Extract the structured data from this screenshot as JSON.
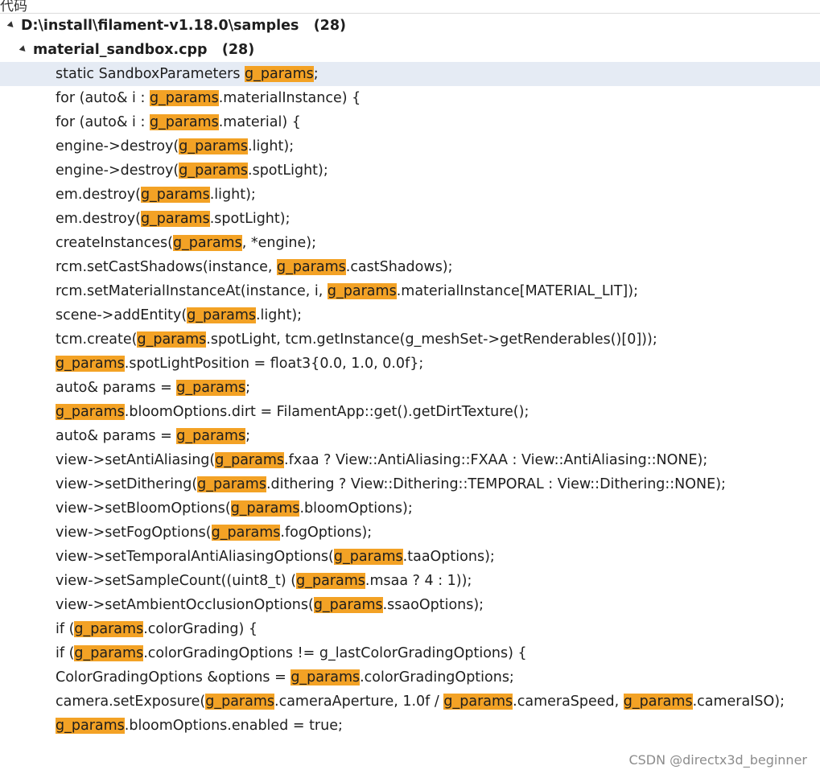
{
  "top_label": "代码",
  "tree": {
    "folder": {
      "path": "D:\\install\\filament-v1.18.0\\samples",
      "count": "(28)"
    },
    "file": {
      "name": "material_sandbox.cpp",
      "count": "(28)"
    }
  },
  "results": [
    {
      "selected": true,
      "segments": [
        {
          "t": "static SandboxParameters "
        },
        {
          "t": "g_params",
          "hl": true
        },
        {
          "t": ";"
        }
      ]
    },
    {
      "segments": [
        {
          "t": "for (auto& i : "
        },
        {
          "t": "g_params",
          "hl": true
        },
        {
          "t": ".materialInstance) {"
        }
      ]
    },
    {
      "segments": [
        {
          "t": "for (auto& i : "
        },
        {
          "t": "g_params",
          "hl": true
        },
        {
          "t": ".material) {"
        }
      ]
    },
    {
      "segments": [
        {
          "t": "engine->destroy("
        },
        {
          "t": "g_params",
          "hl": true
        },
        {
          "t": ".light);"
        }
      ]
    },
    {
      "segments": [
        {
          "t": "engine->destroy("
        },
        {
          "t": "g_params",
          "hl": true
        },
        {
          "t": ".spotLight);"
        }
      ]
    },
    {
      "segments": [
        {
          "t": "em.destroy("
        },
        {
          "t": "g_params",
          "hl": true
        },
        {
          "t": ".light);"
        }
      ]
    },
    {
      "segments": [
        {
          "t": "em.destroy("
        },
        {
          "t": "g_params",
          "hl": true
        },
        {
          "t": ".spotLight);"
        }
      ]
    },
    {
      "segments": [
        {
          "t": "createInstances("
        },
        {
          "t": "g_params",
          "hl": true
        },
        {
          "t": ", *engine);"
        }
      ]
    },
    {
      "segments": [
        {
          "t": "rcm.setCastShadows(instance, "
        },
        {
          "t": "g_params",
          "hl": true
        },
        {
          "t": ".castShadows);"
        }
      ]
    },
    {
      "segments": [
        {
          "t": "rcm.setMaterialInstanceAt(instance, i, "
        },
        {
          "t": "g_params",
          "hl": true
        },
        {
          "t": ".materialInstance[MATERIAL_LIT]);"
        }
      ]
    },
    {
      "segments": [
        {
          "t": "scene->addEntity("
        },
        {
          "t": "g_params",
          "hl": true
        },
        {
          "t": ".light);"
        }
      ]
    },
    {
      "segments": [
        {
          "t": "tcm.create("
        },
        {
          "t": "g_params",
          "hl": true
        },
        {
          "t": ".spotLight, tcm.getInstance(g_meshSet->getRenderables()[0]));"
        }
      ]
    },
    {
      "segments": [
        {
          "t": "g_params",
          "hl": true
        },
        {
          "t": ".spotLightPosition = float3{0.0, 1.0, 0.0f};"
        }
      ]
    },
    {
      "segments": [
        {
          "t": "auto& params = "
        },
        {
          "t": "g_params",
          "hl": true
        },
        {
          "t": ";"
        }
      ]
    },
    {
      "segments": [
        {
          "t": "g_params",
          "hl": true
        },
        {
          "t": ".bloomOptions.dirt = FilamentApp::get().getDirtTexture();"
        }
      ]
    },
    {
      "segments": [
        {
          "t": "auto& params = "
        },
        {
          "t": "g_params",
          "hl": true
        },
        {
          "t": ";"
        }
      ]
    },
    {
      "segments": [
        {
          "t": "view->setAntiAliasing("
        },
        {
          "t": "g_params",
          "hl": true
        },
        {
          "t": ".fxaa ? View::AntiAliasing::FXAA : View::AntiAliasing::NONE);"
        }
      ]
    },
    {
      "segments": [
        {
          "t": "view->setDithering("
        },
        {
          "t": "g_params",
          "hl": true
        },
        {
          "t": ".dithering ? View::Dithering::TEMPORAL : View::Dithering::NONE);"
        }
      ]
    },
    {
      "segments": [
        {
          "t": "view->setBloomOptions("
        },
        {
          "t": "g_params",
          "hl": true
        },
        {
          "t": ".bloomOptions);"
        }
      ]
    },
    {
      "segments": [
        {
          "t": "view->setFogOptions("
        },
        {
          "t": "g_params",
          "hl": true
        },
        {
          "t": ".fogOptions);"
        }
      ]
    },
    {
      "segments": [
        {
          "t": "view->setTemporalAntiAliasingOptions("
        },
        {
          "t": "g_params",
          "hl": true
        },
        {
          "t": ".taaOptions);"
        }
      ]
    },
    {
      "segments": [
        {
          "t": "view->setSampleCount((uint8_t) ("
        },
        {
          "t": "g_params",
          "hl": true
        },
        {
          "t": ".msaa ? 4 : 1));"
        }
      ]
    },
    {
      "segments": [
        {
          "t": "view->setAmbientOcclusionOptions("
        },
        {
          "t": "g_params",
          "hl": true
        },
        {
          "t": ".ssaoOptions);"
        }
      ]
    },
    {
      "segments": [
        {
          "t": "if ("
        },
        {
          "t": "g_params",
          "hl": true
        },
        {
          "t": ".colorGrading) {"
        }
      ]
    },
    {
      "segments": [
        {
          "t": "if ("
        },
        {
          "t": "g_params",
          "hl": true
        },
        {
          "t": ".colorGradingOptions != g_lastColorGradingOptions) {"
        }
      ]
    },
    {
      "segments": [
        {
          "t": "ColorGradingOptions &options = "
        },
        {
          "t": "g_params",
          "hl": true
        },
        {
          "t": ".colorGradingOptions;"
        }
      ]
    },
    {
      "segments": [
        {
          "t": "camera.setExposure("
        },
        {
          "t": "g_params",
          "hl": true
        },
        {
          "t": ".cameraAperture, 1.0f / "
        },
        {
          "t": "g_params",
          "hl": true
        },
        {
          "t": ".cameraSpeed, "
        },
        {
          "t": "g_params",
          "hl": true
        },
        {
          "t": ".cameraISO);"
        }
      ]
    },
    {
      "segments": [
        {
          "t": "g_params",
          "hl": true
        },
        {
          "t": ".bloomOptions.enabled = true;"
        }
      ]
    }
  ],
  "watermark": "CSDN @directx3d_beginner",
  "colors": {
    "highlight": "#f3a225",
    "selected_row": "#e5ebf4"
  }
}
